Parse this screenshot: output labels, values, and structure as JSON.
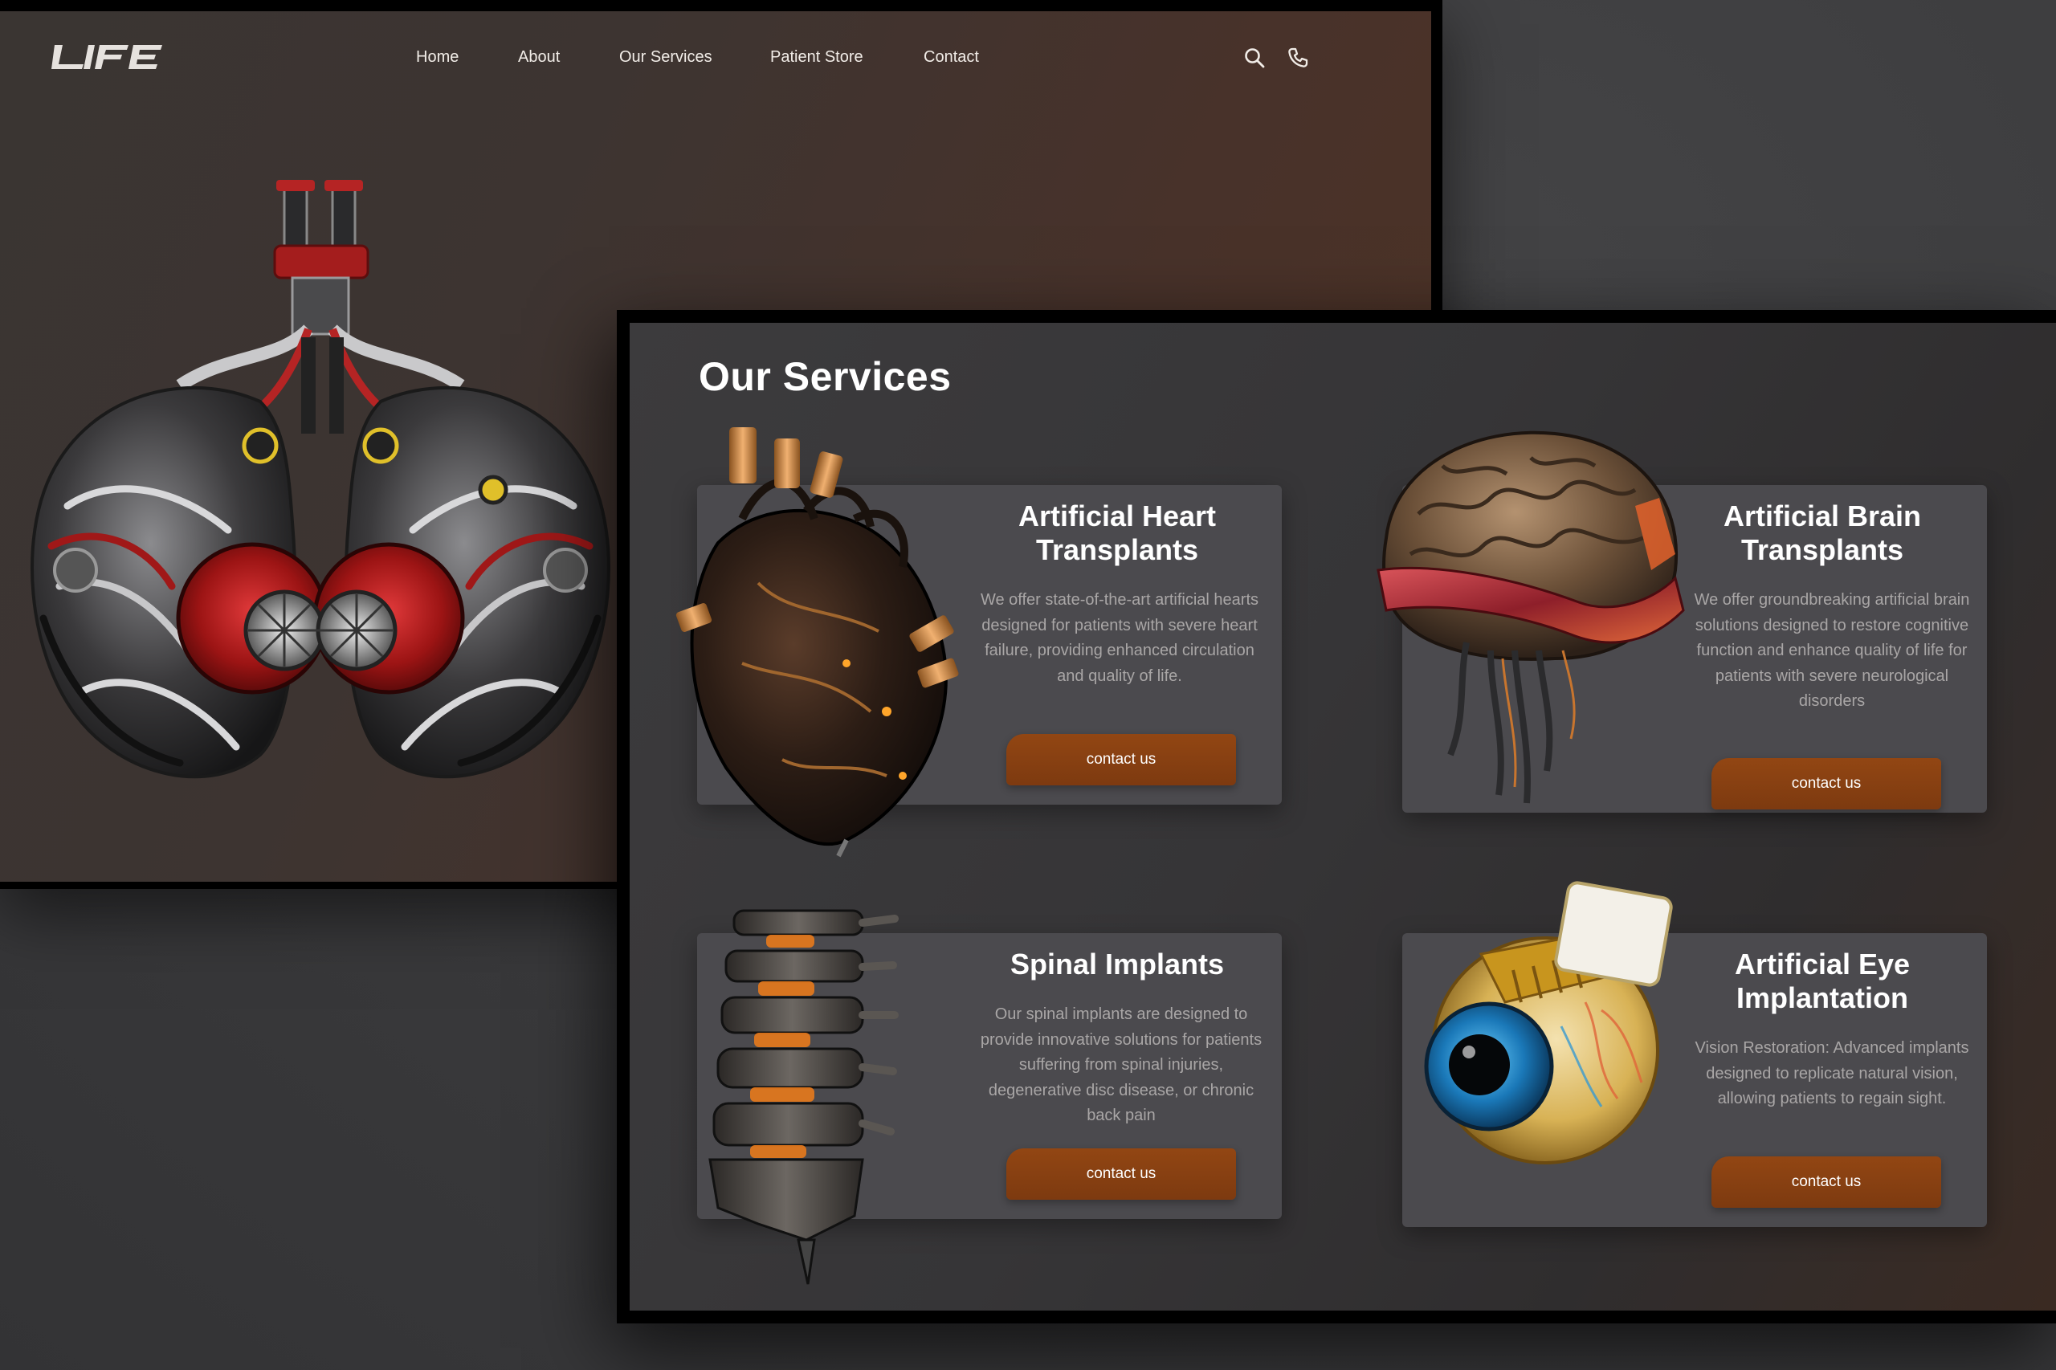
{
  "brand": {
    "logo_text": "LIFE"
  },
  "nav": {
    "items": [
      {
        "label": "Home"
      },
      {
        "label": "About"
      },
      {
        "label": "Our Services"
      },
      {
        "label": "Patient Store"
      },
      {
        "label": "Contact"
      }
    ],
    "icons": [
      "search-icon",
      "phone-icon"
    ]
  },
  "hero": {
    "image": "mechanical-lungs"
  },
  "services": {
    "title": "Our Services",
    "cards": [
      {
        "title": "Artificial Heart\nTransplants",
        "description": "We offer state-of-the-art artificial hearts designed for patients with severe heart failure, providing enhanced circulation and quality of life.",
        "button": "contact us",
        "image": "mechanical-heart"
      },
      {
        "title": "Artificial Brain\nTransplants",
        "description": "We offer groundbreaking artificial brain solutions designed to restore cognitive function and enhance quality of life for patients with severe neurological disorders",
        "button": "contact us",
        "image": "mechanical-brain"
      },
      {
        "title": "Spinal Implants",
        "description": "Our spinal implants are designed to provide innovative solutions for patients suffering from spinal injuries, degenerative disc disease, or chronic back pain",
        "button": "contact us",
        "image": "mechanical-spine"
      },
      {
        "title": "Artificial Eye\nImplantation",
        "description": "Vision Restoration: Advanced implants designed to replicate natural vision, allowing patients to regain sight.",
        "button": "contact us",
        "image": "artificial-eye"
      }
    ]
  },
  "colors": {
    "accent": "#8a4112",
    "card_bg": "#4b4a4e",
    "text_muted": "#a9a6a6"
  }
}
